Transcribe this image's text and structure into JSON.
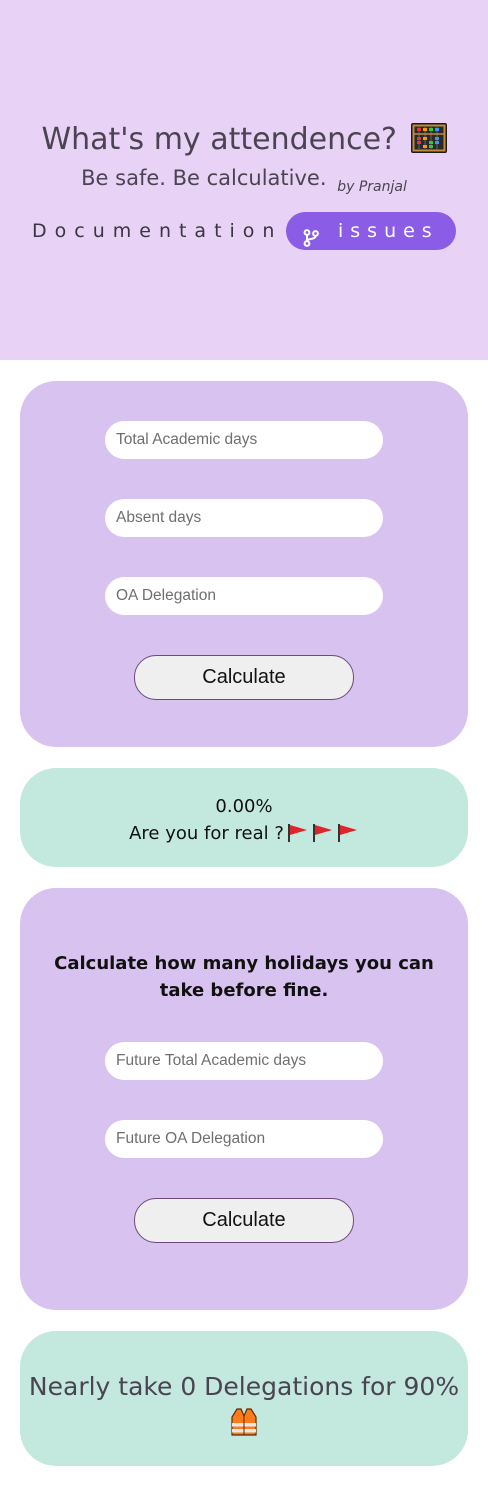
{
  "header": {
    "title": "What's my attendence?",
    "title_emoji": "abacus-emoji",
    "tagline": "Be safe. Be calculative.",
    "byline": "by Pranjal",
    "doc_link": "Documentation",
    "issues_label": "issues",
    "issues_icon": "git-branch-icon",
    "colors": {
      "hero_bg": "#e8d3f6",
      "issues_bg": "#8b5ce6"
    }
  },
  "attendance_form": {
    "total_days_placeholder": "Total Academic days",
    "absent_days_placeholder": "Absent days",
    "oa_delegation_placeholder": "OA Delegation",
    "calculate_label": "Calculate"
  },
  "attendance_result": {
    "percentage": "0.00%",
    "message": "Are you for real ?",
    "flag_emoji": "red-flag-emoji",
    "flag_count": 3
  },
  "holiday_form": {
    "heading": "Calculate how many holidays you can take before fine.",
    "future_total_days_placeholder": "Future Total Academic days",
    "future_oa_delegation_placeholder": "Future OA Delegation",
    "calculate_label": "Calculate"
  },
  "holiday_result": {
    "message": "Nearly take 0 Delegations for 90%",
    "emoji": "safety-vest-emoji"
  },
  "colors": {
    "card_purple": "#d8c2ef",
    "card_green": "#c3e9df"
  }
}
